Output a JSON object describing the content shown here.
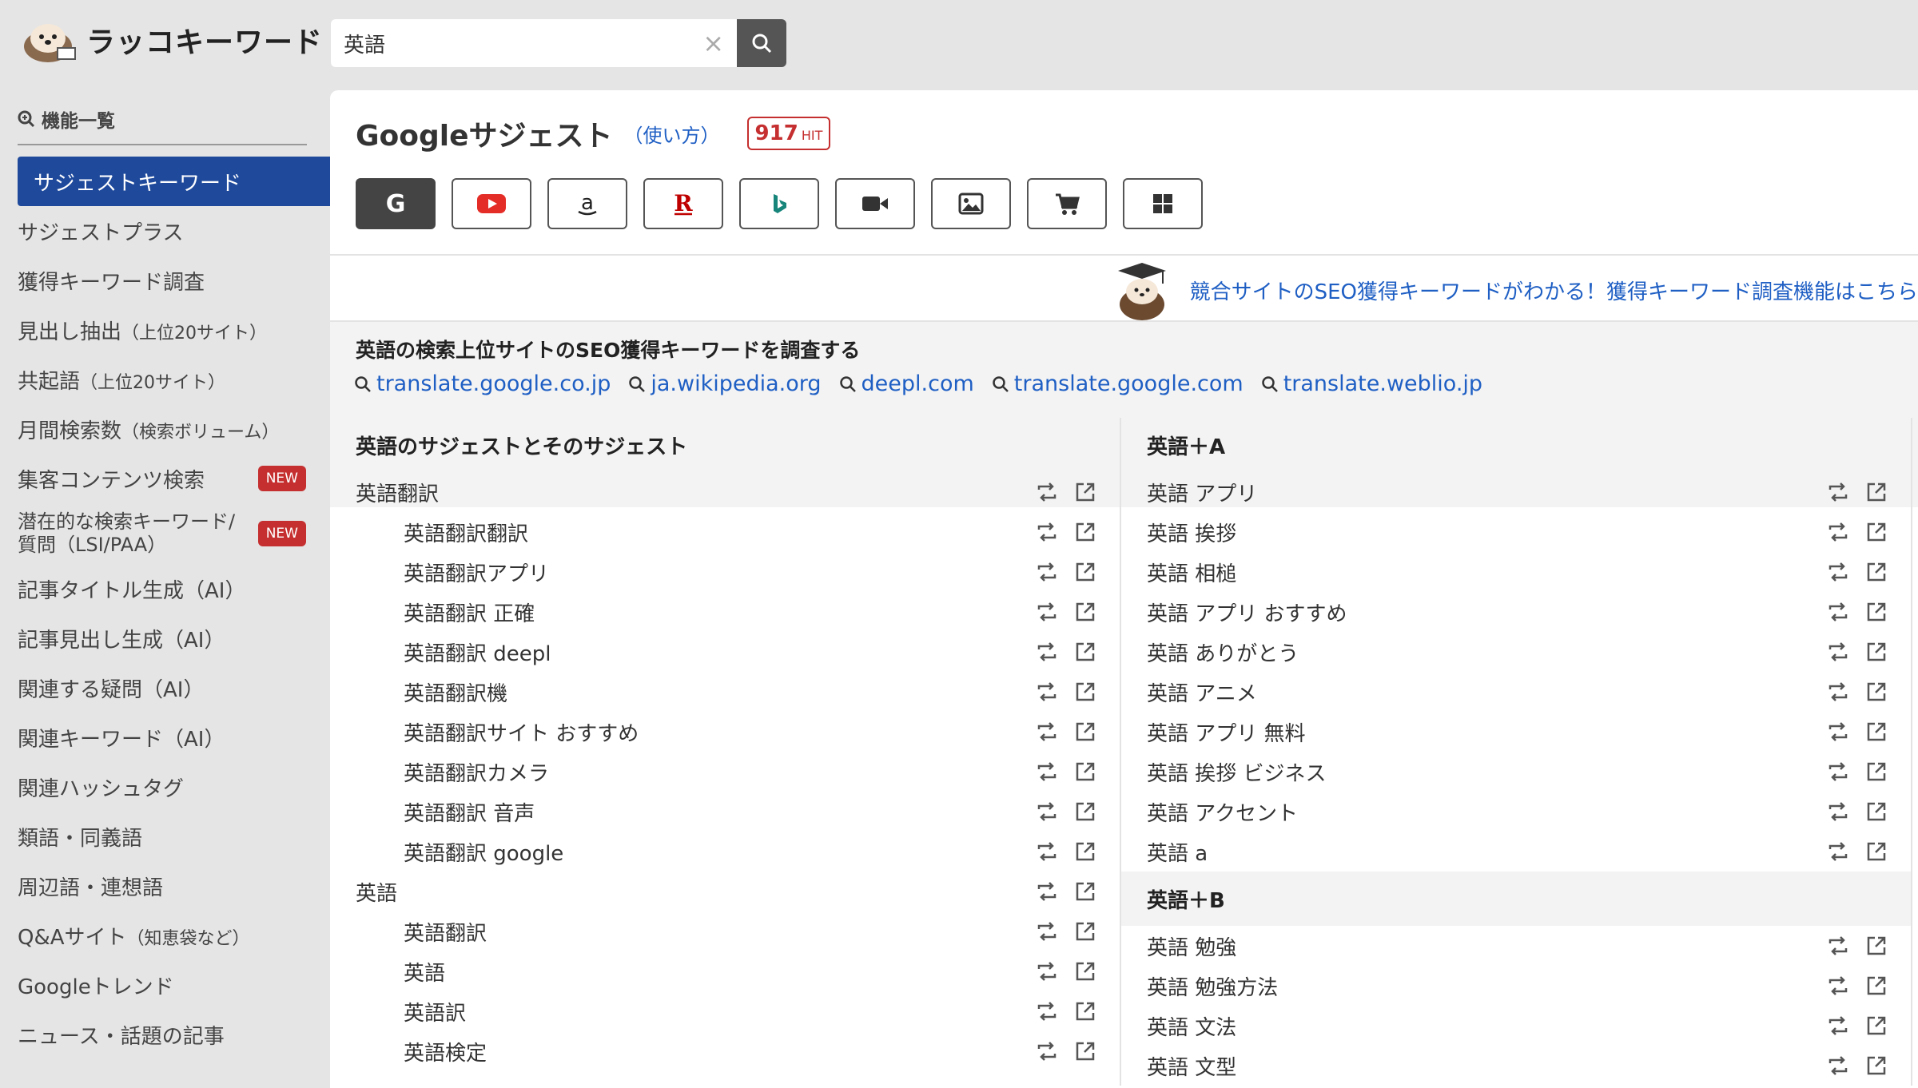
{
  "app": {
    "name": "ラッコキーワード"
  },
  "search": {
    "value": "英語",
    "placeholder": ""
  },
  "sidebar": {
    "heading": "機能一覧",
    "items": [
      {
        "label": "サジェストキーワード",
        "active": true
      },
      {
        "label": "サジェストプラス"
      },
      {
        "label": "獲得キーワード調査"
      },
      {
        "label": "見出し抽出",
        "note": "（上位20サイト）"
      },
      {
        "label": "共起語",
        "note": "（上位20サイト）"
      },
      {
        "label": "月間検索数",
        "note": "（検索ボリューム）"
      },
      {
        "label": "集客コンテンツ検索",
        "badge": "NEW"
      },
      {
        "label": "潜在的な検索キーワード/質問（LSI/PAA）",
        "badge": "NEW"
      },
      {
        "label": "記事タイトル生成（AI）"
      },
      {
        "label": "記事見出し生成（AI）"
      },
      {
        "label": "関連する疑問（AI）"
      },
      {
        "label": "関連キーワード（AI）"
      },
      {
        "label": "関連ハッシュタグ"
      },
      {
        "label": "類語・同義語"
      },
      {
        "label": "周辺語・連想語"
      },
      {
        "label": "Q&Aサイト",
        "note": "（知恵袋など）"
      },
      {
        "label": "Googleトレンド"
      },
      {
        "label": "ニュース・話題の記事"
      }
    ]
  },
  "main": {
    "title": "Googleサジェスト",
    "usage_link": "（使い方）",
    "hit_count": "917",
    "hit_unit": "HIT",
    "engines": [
      "google",
      "youtube",
      "amazon",
      "rakuten",
      "bing",
      "video",
      "image",
      "shopping",
      "apps"
    ],
    "promo": "競合サイトのSEO獲得キーワードがわかる！獲得キーワード調査機能はこちら",
    "seo_title": "英語の検索上位サイトのSEO獲得キーワードを調査する",
    "seo_links": [
      "translate.google.co.jp",
      "ja.wikipedia.org",
      "deepl.com",
      "translate.google.com",
      "translate.weblio.jp"
    ],
    "left_column": {
      "heading": "英語のサジェストとそのサジェスト",
      "rows": [
        {
          "text": "英語翻訳",
          "level": 0
        },
        {
          "text": "英語翻訳翻訳",
          "level": 1
        },
        {
          "text": "英語翻訳アプリ",
          "level": 1
        },
        {
          "text": "英語翻訳 正確",
          "level": 1
        },
        {
          "text": "英語翻訳 deepl",
          "level": 1
        },
        {
          "text": "英語翻訳機",
          "level": 1
        },
        {
          "text": "英語翻訳サイト おすすめ",
          "level": 1
        },
        {
          "text": "英語翻訳カメラ",
          "level": 1
        },
        {
          "text": "英語翻訳 音声",
          "level": 1
        },
        {
          "text": "英語翻訳 google",
          "level": 1
        },
        {
          "text": "英語",
          "level": 0
        },
        {
          "text": "英語翻訳",
          "level": 1
        },
        {
          "text": "英語",
          "level": 1
        },
        {
          "text": "英語訳",
          "level": 1
        },
        {
          "text": "英語検定",
          "level": 1
        }
      ]
    },
    "right_column": {
      "groups": [
        {
          "heading": "英語＋A",
          "rows": [
            "英語 アプリ",
            "英語 挨拶",
            "英語 相槌",
            "英語 アプリ おすすめ",
            "英語 ありがとう",
            "英語 アニメ",
            "英語 アプリ 無料",
            "英語 挨拶 ビジネス",
            "英語 アクセント",
            "英語 a"
          ]
        },
        {
          "heading": "英語＋B",
          "rows": [
            "英語 勉強",
            "英語 勉強方法",
            "英語 文法",
            "英語 文型"
          ]
        }
      ]
    }
  },
  "colors": {
    "accent": "#1f4a9c",
    "badge": "#c52f2f",
    "link": "#1f5fc4"
  }
}
